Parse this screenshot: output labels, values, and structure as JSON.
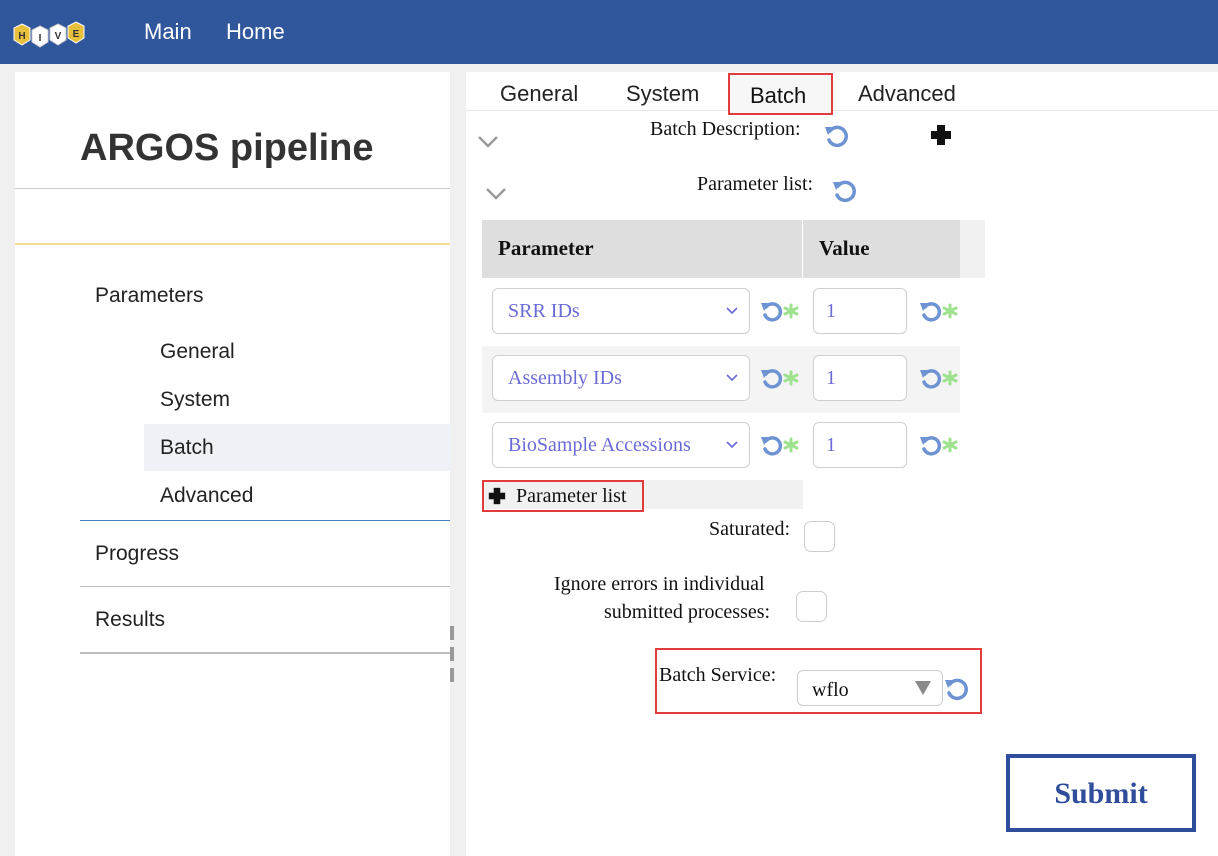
{
  "topbar": {
    "logo_letters": [
      "H",
      "I",
      "V",
      "E"
    ],
    "nav": [
      "Main",
      "Home"
    ]
  },
  "left": {
    "title": "ARGOS pipeline",
    "sections": {
      "parameters": "Parameters",
      "sub": [
        "General",
        "System",
        "Batch",
        "Advanced"
      ],
      "progress": "Progress",
      "results": "Results"
    },
    "active_sub": "Batch"
  },
  "tabs": [
    "General",
    "System",
    "Batch",
    "Advanced"
  ],
  "active_tab": "Batch",
  "form": {
    "batch_description_label": "Batch Description:",
    "parameter_list_label": "Parameter list:",
    "table": {
      "headers": [
        "Parameter",
        "Value"
      ],
      "rows": [
        {
          "param": "SRR IDs",
          "value": "1"
        },
        {
          "param": "Assembly IDs",
          "value": "1"
        },
        {
          "param": "BioSample Accessions",
          "value": "1"
        }
      ]
    },
    "add_parameter_label": "Parameter list",
    "saturated_label": "Saturated:",
    "ignore_errors_line1": "Ignore errors in individual",
    "ignore_errors_line2": "submitted processes:",
    "batch_service_label": "Batch Service:",
    "batch_service_value": "wflo",
    "submit_label": "Submit"
  },
  "colors": {
    "topbar": "#30569c",
    "highlight": "#e23b3b",
    "select_text": "#6b6bd6",
    "reset_icon": "#6d93d3",
    "star_icon": "#9ee28f",
    "submit": "#2f4d9b"
  }
}
